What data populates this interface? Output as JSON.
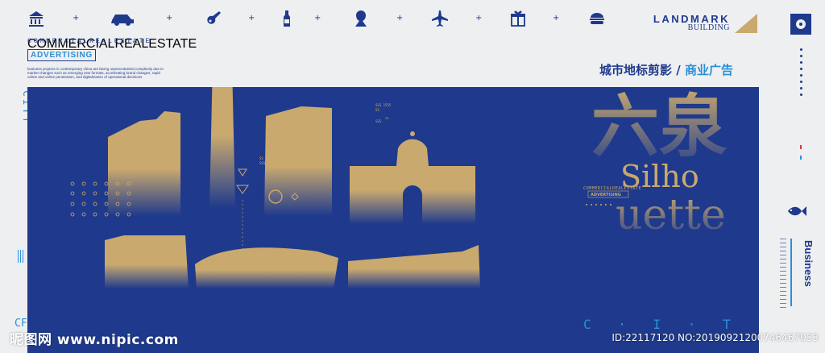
{
  "header": {
    "tagline": "COMMERCIALREALESTATE",
    "badge": "ADVERTISING",
    "body_copy": "business projects in contemporary china are facing unprecedented complexity due to market changes such as emerging new formats, accelerating brand changes, rapid online and online penetration, and digitalization of operational decisions",
    "brand_title": "LANDMARK",
    "brand_subtitle": "BUILDING",
    "chinese_title": "城市地标剪影 / ",
    "chinese_highlight": "商业广告",
    "icons": [
      "bank-icon",
      "car-icon",
      "guitar-icon",
      "bottle-icon",
      "portrait-icon",
      "airplane-icon",
      "gift-icon",
      "burger-icon"
    ]
  },
  "side": {
    "vertical_city": "CITY",
    "business": "Business"
  },
  "hero": {
    "big_chinese": "六泉",
    "silhouette_1": "Silho",
    "silhouette_2": "uette",
    "small_tagline": "COMMERCIALREALESTATE",
    "small_badge": "ADVERTISING",
    "city_spaced": "C · I · T · Y",
    "corner_cf": "CF"
  },
  "footer": {
    "watermark": "昵图网 www.nipic.com",
    "image_id": "ID:22117120 NO:20190921200746467033"
  },
  "colors": {
    "page_bg": "#eeeff1",
    "navy": "#1f3a8c",
    "gold": "#c9a96e",
    "accent_blue": "#2b8fd6",
    "accent_red": "#d9333f"
  }
}
